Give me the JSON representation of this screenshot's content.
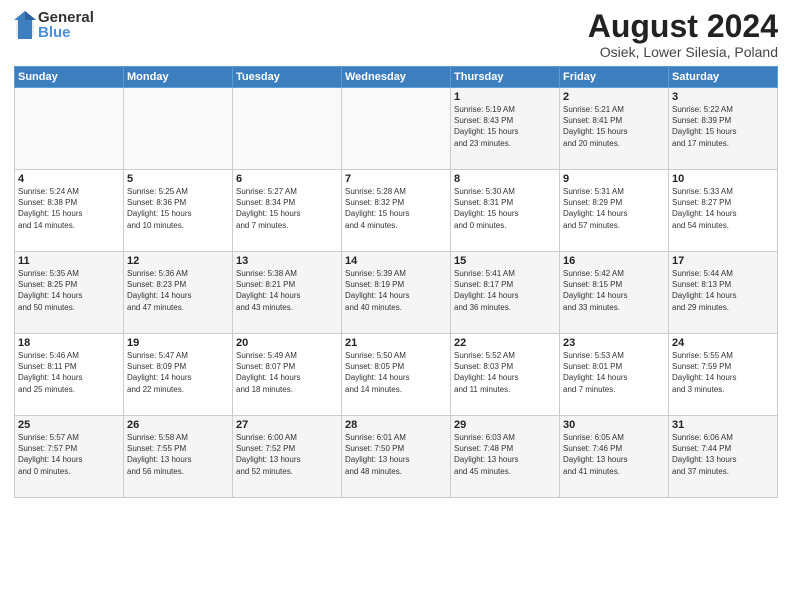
{
  "header": {
    "logo_general": "General",
    "logo_blue": "Blue",
    "month_year": "August 2024",
    "location": "Osiek, Lower Silesia, Poland"
  },
  "days_of_week": [
    "Sunday",
    "Monday",
    "Tuesday",
    "Wednesday",
    "Thursday",
    "Friday",
    "Saturday"
  ],
  "weeks": [
    [
      {
        "day": "",
        "info": ""
      },
      {
        "day": "",
        "info": ""
      },
      {
        "day": "",
        "info": ""
      },
      {
        "day": "",
        "info": ""
      },
      {
        "day": "1",
        "info": "Sunrise: 5:19 AM\nSunset: 8:43 PM\nDaylight: 15 hours\nand 23 minutes."
      },
      {
        "day": "2",
        "info": "Sunrise: 5:21 AM\nSunset: 8:41 PM\nDaylight: 15 hours\nand 20 minutes."
      },
      {
        "day": "3",
        "info": "Sunrise: 5:22 AM\nSunset: 8:39 PM\nDaylight: 15 hours\nand 17 minutes."
      }
    ],
    [
      {
        "day": "4",
        "info": "Sunrise: 5:24 AM\nSunset: 8:38 PM\nDaylight: 15 hours\nand 14 minutes."
      },
      {
        "day": "5",
        "info": "Sunrise: 5:25 AM\nSunset: 8:36 PM\nDaylight: 15 hours\nand 10 minutes."
      },
      {
        "day": "6",
        "info": "Sunrise: 5:27 AM\nSunset: 8:34 PM\nDaylight: 15 hours\nand 7 minutes."
      },
      {
        "day": "7",
        "info": "Sunrise: 5:28 AM\nSunset: 8:32 PM\nDaylight: 15 hours\nand 4 minutes."
      },
      {
        "day": "8",
        "info": "Sunrise: 5:30 AM\nSunset: 8:31 PM\nDaylight: 15 hours\nand 0 minutes."
      },
      {
        "day": "9",
        "info": "Sunrise: 5:31 AM\nSunset: 8:29 PM\nDaylight: 14 hours\nand 57 minutes."
      },
      {
        "day": "10",
        "info": "Sunrise: 5:33 AM\nSunset: 8:27 PM\nDaylight: 14 hours\nand 54 minutes."
      }
    ],
    [
      {
        "day": "11",
        "info": "Sunrise: 5:35 AM\nSunset: 8:25 PM\nDaylight: 14 hours\nand 50 minutes."
      },
      {
        "day": "12",
        "info": "Sunrise: 5:36 AM\nSunset: 8:23 PM\nDaylight: 14 hours\nand 47 minutes."
      },
      {
        "day": "13",
        "info": "Sunrise: 5:38 AM\nSunset: 8:21 PM\nDaylight: 14 hours\nand 43 minutes."
      },
      {
        "day": "14",
        "info": "Sunrise: 5:39 AM\nSunset: 8:19 PM\nDaylight: 14 hours\nand 40 minutes."
      },
      {
        "day": "15",
        "info": "Sunrise: 5:41 AM\nSunset: 8:17 PM\nDaylight: 14 hours\nand 36 minutes."
      },
      {
        "day": "16",
        "info": "Sunrise: 5:42 AM\nSunset: 8:15 PM\nDaylight: 14 hours\nand 33 minutes."
      },
      {
        "day": "17",
        "info": "Sunrise: 5:44 AM\nSunset: 8:13 PM\nDaylight: 14 hours\nand 29 minutes."
      }
    ],
    [
      {
        "day": "18",
        "info": "Sunrise: 5:46 AM\nSunset: 8:11 PM\nDaylight: 14 hours\nand 25 minutes."
      },
      {
        "day": "19",
        "info": "Sunrise: 5:47 AM\nSunset: 8:09 PM\nDaylight: 14 hours\nand 22 minutes."
      },
      {
        "day": "20",
        "info": "Sunrise: 5:49 AM\nSunset: 8:07 PM\nDaylight: 14 hours\nand 18 minutes."
      },
      {
        "day": "21",
        "info": "Sunrise: 5:50 AM\nSunset: 8:05 PM\nDaylight: 14 hours\nand 14 minutes."
      },
      {
        "day": "22",
        "info": "Sunrise: 5:52 AM\nSunset: 8:03 PM\nDaylight: 14 hours\nand 11 minutes."
      },
      {
        "day": "23",
        "info": "Sunrise: 5:53 AM\nSunset: 8:01 PM\nDaylight: 14 hours\nand 7 minutes."
      },
      {
        "day": "24",
        "info": "Sunrise: 5:55 AM\nSunset: 7:59 PM\nDaylight: 14 hours\nand 3 minutes."
      }
    ],
    [
      {
        "day": "25",
        "info": "Sunrise: 5:57 AM\nSunset: 7:57 PM\nDaylight: 14 hours\nand 0 minutes."
      },
      {
        "day": "26",
        "info": "Sunrise: 5:58 AM\nSunset: 7:55 PM\nDaylight: 13 hours\nand 56 minutes."
      },
      {
        "day": "27",
        "info": "Sunrise: 6:00 AM\nSunset: 7:52 PM\nDaylight: 13 hours\nand 52 minutes."
      },
      {
        "day": "28",
        "info": "Sunrise: 6:01 AM\nSunset: 7:50 PM\nDaylight: 13 hours\nand 48 minutes."
      },
      {
        "day": "29",
        "info": "Sunrise: 6:03 AM\nSunset: 7:48 PM\nDaylight: 13 hours\nand 45 minutes."
      },
      {
        "day": "30",
        "info": "Sunrise: 6:05 AM\nSunset: 7:46 PM\nDaylight: 13 hours\nand 41 minutes."
      },
      {
        "day": "31",
        "info": "Sunrise: 6:06 AM\nSunset: 7:44 PM\nDaylight: 13 hours\nand 37 minutes."
      }
    ]
  ]
}
